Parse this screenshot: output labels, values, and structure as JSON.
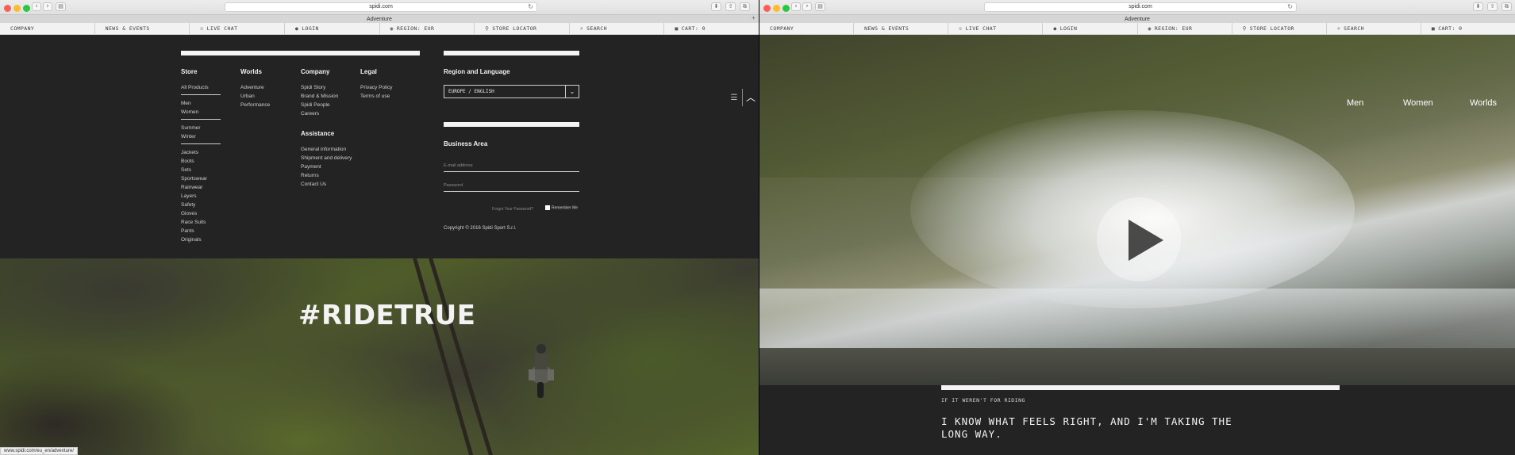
{
  "left": {
    "browser": {
      "url": "spidi.com",
      "tab_title": "Adventure",
      "status_url": "www.spidi.com/eu_en/adventure/"
    },
    "nav": [
      "COMPANY",
      "NEWS & EVENTS",
      "LIVE CHAT",
      "LOGIN",
      "REGION: EUR",
      "STORE LOCATOR",
      "SEARCH",
      "CART: 0"
    ],
    "footer": {
      "store": {
        "heading": "Store",
        "groups": [
          [
            "All Products"
          ],
          [
            "Men",
            "Women"
          ],
          [
            "Summer",
            "Winter"
          ],
          [
            "Jackets",
            "Boots",
            "Sets",
            "Sportswear",
            "Rainwear",
            "Layers",
            "Safety",
            "Gloves",
            "Race Suits",
            "Pants",
            "Originals"
          ]
        ]
      },
      "worlds": {
        "heading": "Worlds",
        "items": [
          "Adventure",
          "Urban",
          "Performance"
        ]
      },
      "company": {
        "heading": "Company",
        "items": [
          "Spidi Story",
          "Brand & Mission",
          "Spidi People",
          "Careers"
        ]
      },
      "assistance": {
        "heading": "Assistance",
        "items": [
          "General information",
          "Shipment and delivery",
          "Payment",
          "Returns",
          "Contact Us"
        ]
      },
      "legal": {
        "heading": "Legal",
        "items": [
          "Privacy Policy",
          "Terms of use"
        ]
      },
      "region": {
        "heading": "Region and Language",
        "selected": "EUROPE / ENGLISH"
      },
      "business": {
        "heading": "Business Area",
        "email_placeholder": "E-mail address",
        "password_placeholder": "Password",
        "forgot": "Forgot Your Password?",
        "remember": "Remember Me"
      },
      "copyright": "Copyright © 2016 Spidi Sport S.r.l."
    },
    "hero": {
      "headline": "#RIDETRUE"
    }
  },
  "right": {
    "browser": {
      "url": "spidi.com",
      "tab_title": "Adventure"
    },
    "nav": [
      "COMPANY",
      "NEWS & EVENTS",
      "LIVE CHAT",
      "LOGIN",
      "REGION: EUR",
      "STORE LOCATOR",
      "SEARCH",
      "CART: 0"
    ],
    "hero_nav": [
      "Men",
      "Women",
      "Worlds"
    ],
    "intro": {
      "kicker": "IF IT WEREN'T FOR RIDING",
      "headline": "I KNOW WHAT FEELS RIGHT, AND I'M TAKING THE LONG WAY."
    }
  },
  "icons": {
    "live_chat": "chat-icon",
    "login": "user-icon",
    "region": "globe-icon",
    "store_locator": "pin-icon",
    "search": "search-icon",
    "cart": "bag-icon"
  }
}
